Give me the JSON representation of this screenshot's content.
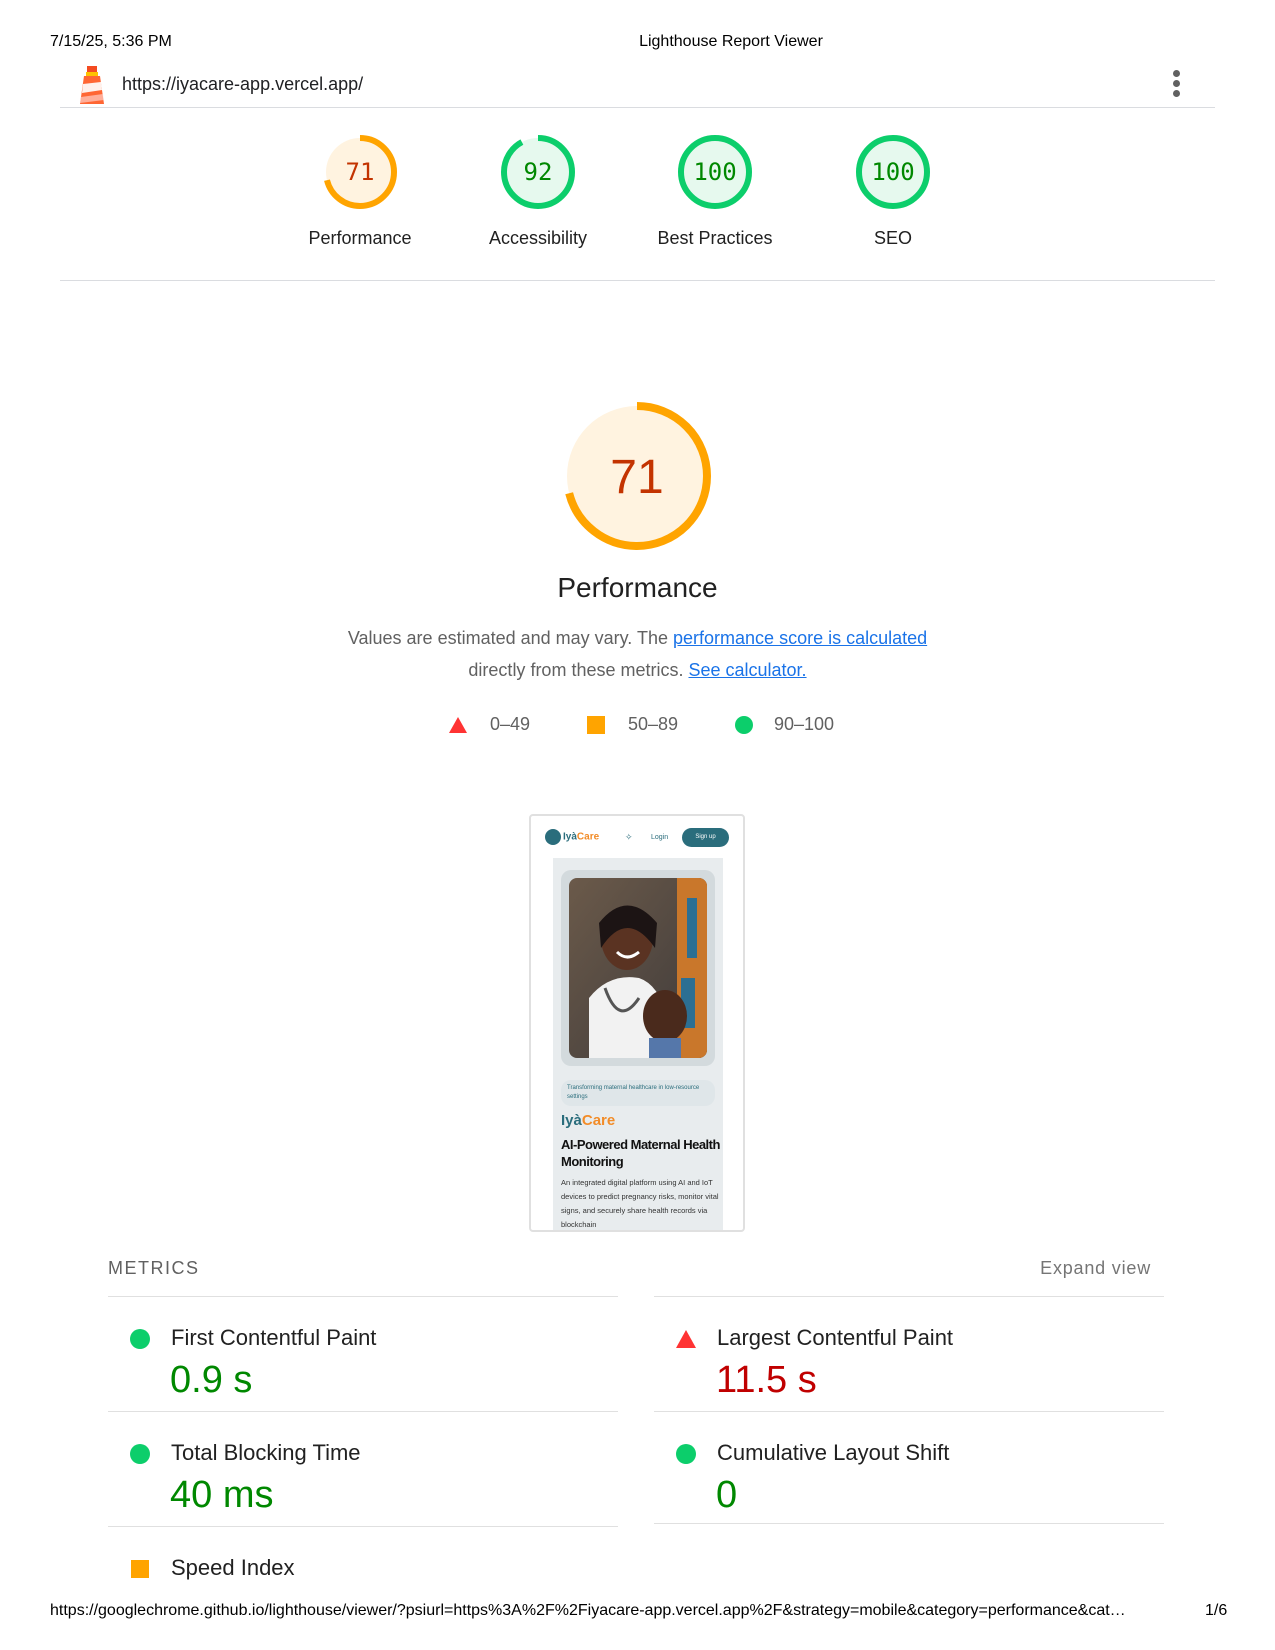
{
  "print": {
    "date": "7/15/25, 5:36 PM",
    "title": "Lighthouse Report Viewer",
    "footer_url": "https://googlechrome.github.io/lighthouse/viewer/?psiurl=https%3A%2F%2Fiyacare-app.vercel.app%2F&strategy=mobile&category=performance&cat…",
    "page": "1/6"
  },
  "topbar": {
    "url": "https://iyacare-app.vercel.app/",
    "logo_icon": "lighthouse-icon",
    "menu_icon": "kebab-menu-icon"
  },
  "gauges": [
    {
      "score": 71,
      "label": "Performance",
      "status": "average"
    },
    {
      "score": 92,
      "label": "Accessibility",
      "status": "pass"
    },
    {
      "score": 100,
      "label": "Best Practices",
      "status": "pass"
    },
    {
      "score": 100,
      "label": "SEO",
      "status": "pass"
    }
  ],
  "performance": {
    "score": 71,
    "title": "Performance",
    "desc_part1": "Values are estimated and may vary. The ",
    "desc_link1": "performance score is calculated",
    "desc_part2": "directly from these metrics. ",
    "desc_link2": "See calculator."
  },
  "legend": [
    {
      "shape": "triangle",
      "range": "0–49"
    },
    {
      "shape": "square",
      "range": "50–89"
    },
    {
      "shape": "circle",
      "range": "90–100"
    }
  ],
  "screenshot": {
    "logo_a": "Iyà",
    "logo_b": "Care",
    "login": "Login",
    "signup": "Sign up",
    "tagline": "Transforming maternal healthcare in low-resource settings",
    "brand_a": "Iyà",
    "brand_b": "Care",
    "headline": "AI-Powered Maternal Health Monitoring",
    "blurb": "An integrated digital platform using AI and IoT devices to predict pregnancy risks, monitor vital signs, and securely share health records via blockchain"
  },
  "metrics": {
    "heading": "METRICS",
    "expand": "Expand view",
    "items": [
      {
        "name": "First Contentful Paint",
        "value": "0.9 s",
        "status": "pass"
      },
      {
        "name": "Largest Contentful Paint",
        "value": "11.5 s",
        "status": "fail"
      },
      {
        "name": "Total Blocking Time",
        "value": "40 ms",
        "status": "pass"
      },
      {
        "name": "Cumulative Layout Shift",
        "value": "0",
        "status": "pass"
      },
      {
        "name": "Speed Index",
        "value": "",
        "status": "average"
      }
    ]
  },
  "colors": {
    "pass": "#0cce6b",
    "pass_text": "#008800",
    "average": "#ffa400",
    "average_text": "#c33300",
    "fail": "#ff4e42",
    "fail_text": "#c00000"
  }
}
